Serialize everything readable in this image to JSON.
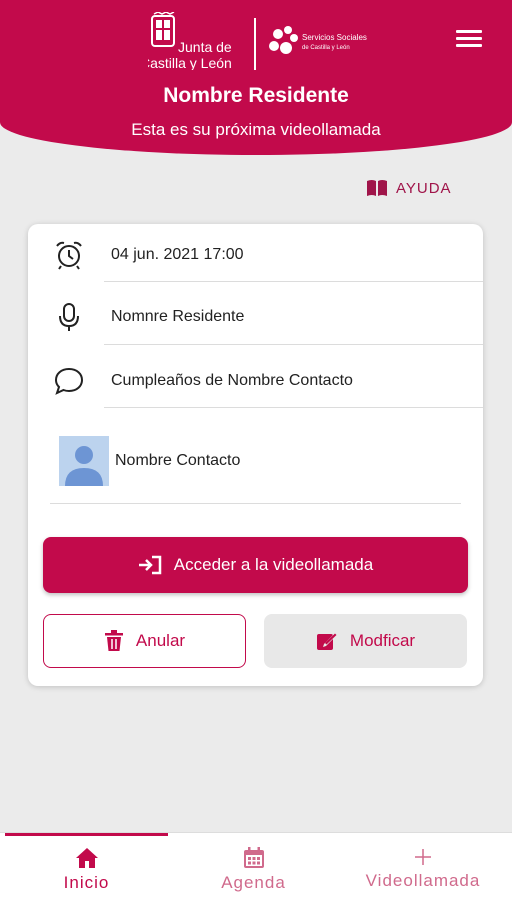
{
  "header": {
    "logo_jcyl": [
      "Junta de",
      "Castilla y León"
    ],
    "logo_ss": [
      "Servicios Sociales",
      "de Castilla y León"
    ],
    "resident_name": "Nombre Residente",
    "subtitle": "Esta es su próxima videollamada"
  },
  "help": {
    "label": "AYUDA",
    "icon": "book-icon"
  },
  "call": {
    "datetime": "04 jun. 2021 17:00",
    "resident": "Nomnre Residente",
    "topic": "Cumpleaños de Nombre Contacto",
    "contact": "Nombre Contacto"
  },
  "actions": {
    "access_label": "Acceder a la videollamada",
    "cancel_label": "Anular",
    "modify_label": "Modficar"
  },
  "nav": {
    "items": [
      {
        "label": "Inicio",
        "icon": "home-icon",
        "active": true
      },
      {
        "label": "Agenda",
        "icon": "calendar-icon",
        "active": false
      },
      {
        "label": "Videollamada",
        "icon": "plus-icon",
        "active": false
      }
    ]
  },
  "colors": {
    "primary": "#c20a4b",
    "nav_inactive": "#d06a8c",
    "background": "#ebebeb"
  }
}
